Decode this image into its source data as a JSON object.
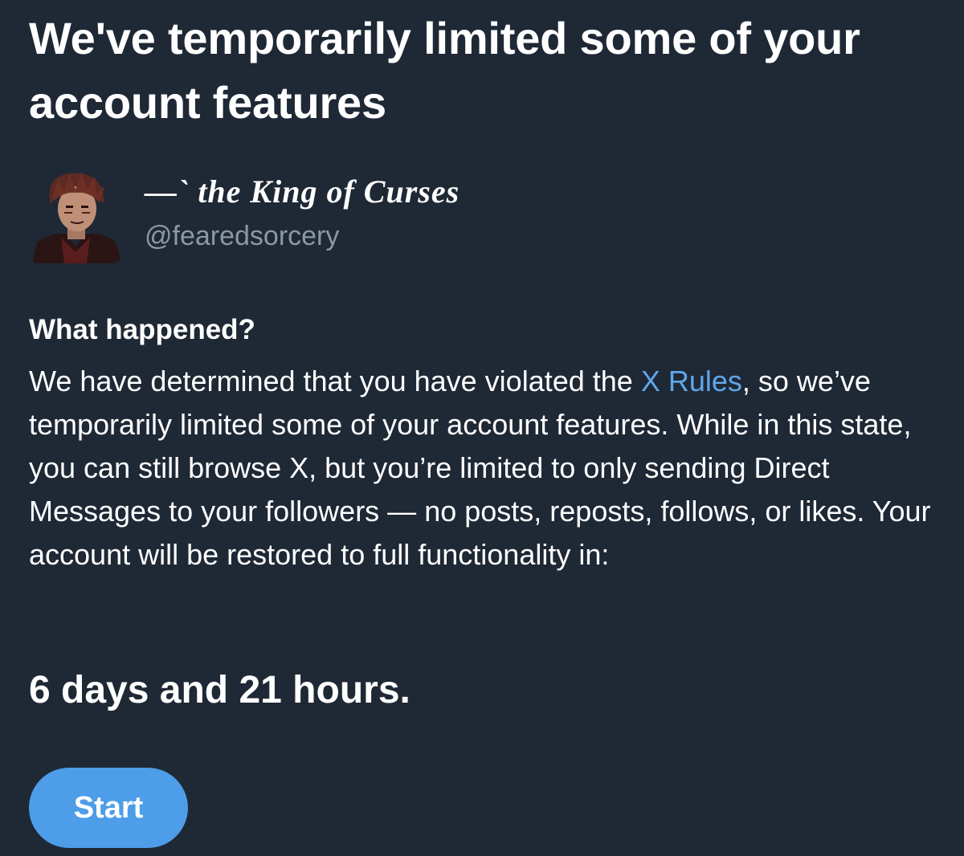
{
  "header": {
    "title": "We've temporarily limited some of your account features"
  },
  "account": {
    "display_name": "—` the King of Curses",
    "handle": "@fearedsorcery",
    "avatar_icon": "profile-avatar"
  },
  "notice": {
    "heading": "What happened?",
    "body_before_link": "We have determined that you have violated the ",
    "link_text": "X Rules",
    "body_after_link": ", so we’ve temporarily limited some of your account features. While in this state, you can still browse X, but you’re limited to only sending Direct Messages to your followers — no posts, reposts, follows, or likes. Your account will be restored to full functionality in:",
    "countdown": "6 days and 21 hours."
  },
  "actions": {
    "start_label": "Start"
  },
  "colors": {
    "background": "#1f2835",
    "text": "#ffffff",
    "muted": "#8b98a5",
    "link": "#5fa7ea",
    "button": "#4d9de8"
  }
}
